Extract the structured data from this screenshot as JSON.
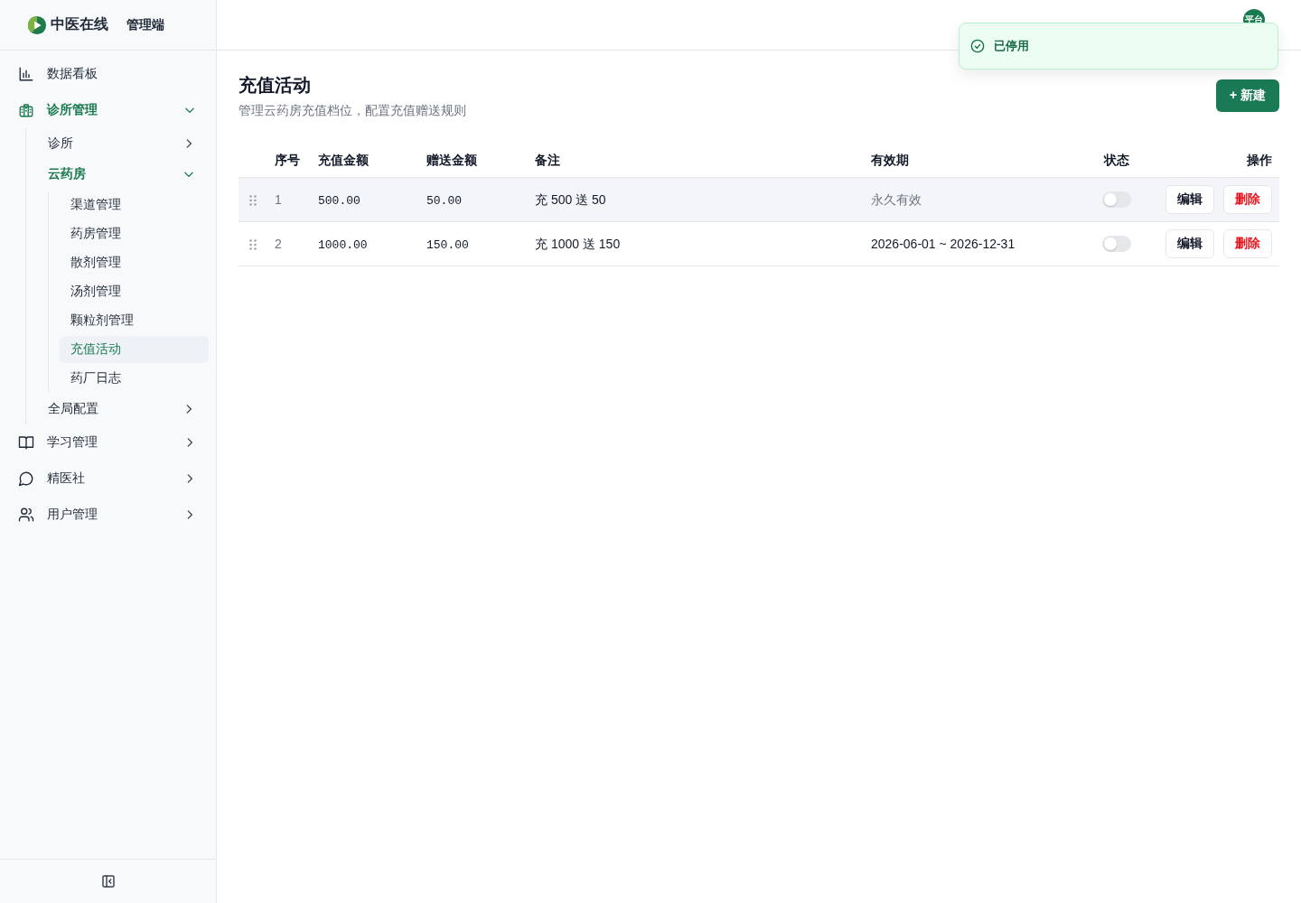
{
  "sidebar": {
    "logo": {
      "name": "中医在线",
      "subtitle": "管理端"
    },
    "nav": [
      {
        "label": "数据看板",
        "kind": "link",
        "selected": false
      },
      {
        "label": "诊所管理",
        "kind": "group",
        "expanded": true,
        "children": [
          {
            "label": "诊所",
            "kind": "group",
            "expanded": false
          },
          {
            "label": "云药房",
            "kind": "group",
            "expanded": true,
            "children": [
              {
                "label": "渠道管理",
                "kind": "link",
                "selected": false
              },
              {
                "label": "药房管理",
                "kind": "link",
                "selected": false
              },
              {
                "label": "散剂管理",
                "kind": "link",
                "selected": false
              },
              {
                "label": "汤剂管理",
                "kind": "link",
                "selected": false
              },
              {
                "label": "颗粒剂管理",
                "kind": "link",
                "selected": false
              },
              {
                "label": "充值活动",
                "kind": "link",
                "selected": true
              },
              {
                "label": "药厂日志",
                "kind": "link",
                "selected": false
              }
            ]
          },
          {
            "label": "全局配置",
            "kind": "group",
            "expanded": false
          }
        ]
      },
      {
        "label": "学习管理",
        "kind": "group",
        "expanded": false
      },
      {
        "label": "精医社",
        "kind": "group",
        "expanded": false
      },
      {
        "label": "用户管理",
        "kind": "group",
        "expanded": false
      }
    ]
  },
  "header": {
    "avatar": "平台"
  },
  "toast": {
    "message": "已停用",
    "kind": "success"
  },
  "page": {
    "title": "充值活动",
    "subtitle": "管理云药房充值档位，配置充值赠送规则",
    "new_button": "+ 新建"
  },
  "table": {
    "columns": [
      "序号",
      "充值金额",
      "赠送金额",
      "备注",
      "有效期",
      "状态",
      "操作"
    ],
    "rows": [
      {
        "index": "1",
        "amount": "500.00",
        "bonus": "50.00",
        "note": "充 500 送 50",
        "validity": "永久有效",
        "validity_muted": true,
        "on": false,
        "highlighted": true,
        "actions": [
          {
            "label": "编辑",
            "kind": "default"
          },
          {
            "label": "删除",
            "kind": "danger"
          }
        ]
      },
      {
        "index": "2",
        "amount": "1000.00",
        "bonus": "150.00",
        "note": "充 1000 送 150",
        "validity": "2026-06-01 ~ 2026-12-31",
        "validity_muted": false,
        "on": false,
        "highlighted": false,
        "actions": [
          {
            "label": "编辑",
            "kind": "default"
          },
          {
            "label": "删除",
            "kind": "danger"
          }
        ]
      }
    ]
  }
}
